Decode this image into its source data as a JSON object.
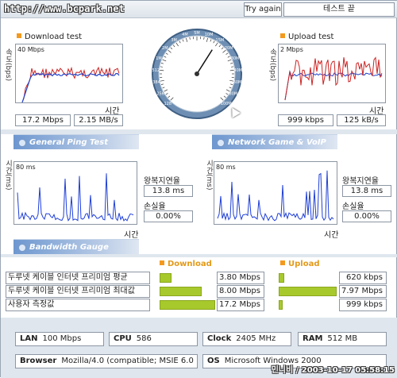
{
  "header": {
    "url": "http://www.bcpark.net",
    "try_again_label": "Try again",
    "test_end_label": "테스트 끝"
  },
  "download": {
    "title": "Download test",
    "y_unit": "속도(bps)",
    "scale_label": "40 Mbps",
    "time_label": "시간",
    "value_bps": "17.2 Mbps",
    "value_bytes": "2.15 MB/s"
  },
  "upload": {
    "title": "Upload test",
    "y_unit": "속도(bps)",
    "scale_label": "2 Mbps",
    "time_label": "시간",
    "value_bps": "999 kbps",
    "value_bytes": "125 kB/s"
  },
  "gauge": {
    "tick_labels": [
      "128",
      "256",
      "384",
      "512",
      "1M",
      "2M",
      "3M",
      "4M",
      "5M",
      "10M",
      "15M",
      "20M",
      "30M",
      "40M",
      "60M",
      "80M",
      "100M"
    ],
    "needle_level": 0.62
  },
  "sections": {
    "ping": "General Ping Test",
    "game": "Network Game & VoIP Test",
    "bandwidth": "Bandwidth Gauge"
  },
  "ping_general": {
    "y_unit": "시간(ms)",
    "scale_label": "80 ms",
    "time_label": "시간",
    "latency_label": "왕복지연율",
    "latency_value": "13.8 ms",
    "loss_label": "손실율",
    "loss_value": "0.00%"
  },
  "ping_game": {
    "y_unit": "시간(ms)",
    "scale_label": "80 ms",
    "time_label": "시간",
    "latency_label": "왕복지연율",
    "latency_value": "13.8 ms",
    "loss_label": "손실율",
    "loss_value": "0.00%"
  },
  "bandwidth": {
    "download_head": "Download",
    "upload_head": "Upload",
    "rows": [
      {
        "name": "두루넷 케이블 인터넷 프리미엄 평균",
        "down": "3.80 Mbps",
        "down_level": 0.22,
        "up": "620 kbps",
        "up_level": 0.09
      },
      {
        "name": "두루넷 케이블 인터넷 프리미엄 최대값",
        "down": "8.00 Mbps",
        "down_level": 0.75,
        "up": "7.97 Mbps",
        "up_level": 0.98
      },
      {
        "name": "사용자 측정값",
        "down": "17.2 Mbps",
        "down_level": 1.0,
        "up": "999 kbps",
        "up_level": 0.07
      }
    ]
  },
  "system": {
    "lan_label": "LAN",
    "lan_value": "100 Mbps",
    "cpu_label": "CPU",
    "cpu_value": "586",
    "clock_label": "Clock",
    "clock_value": "2405 MHz",
    "ram_label": "RAM",
    "ram_value": "512 MB",
    "browser_label": "Browser",
    "browser_value": "Mozilla/4.0 (compatible; MSIE 6.0",
    "os_label": "OS",
    "os_value": "Microsoft Windows 2000"
  },
  "footer": {
    "stamp": "민니비 / 2003-10-17 05:58:15"
  },
  "colors": {
    "accent_orange": "#f39a1e",
    "section_blue": "#6d97cf",
    "bar_green": "#a8c92c",
    "download_line": "#cc2222",
    "download_avg": "#2244cc",
    "upload_line": "#cc2222",
    "upload_avg": "#2244cc",
    "ping_line": "#1f3fd6"
  }
}
